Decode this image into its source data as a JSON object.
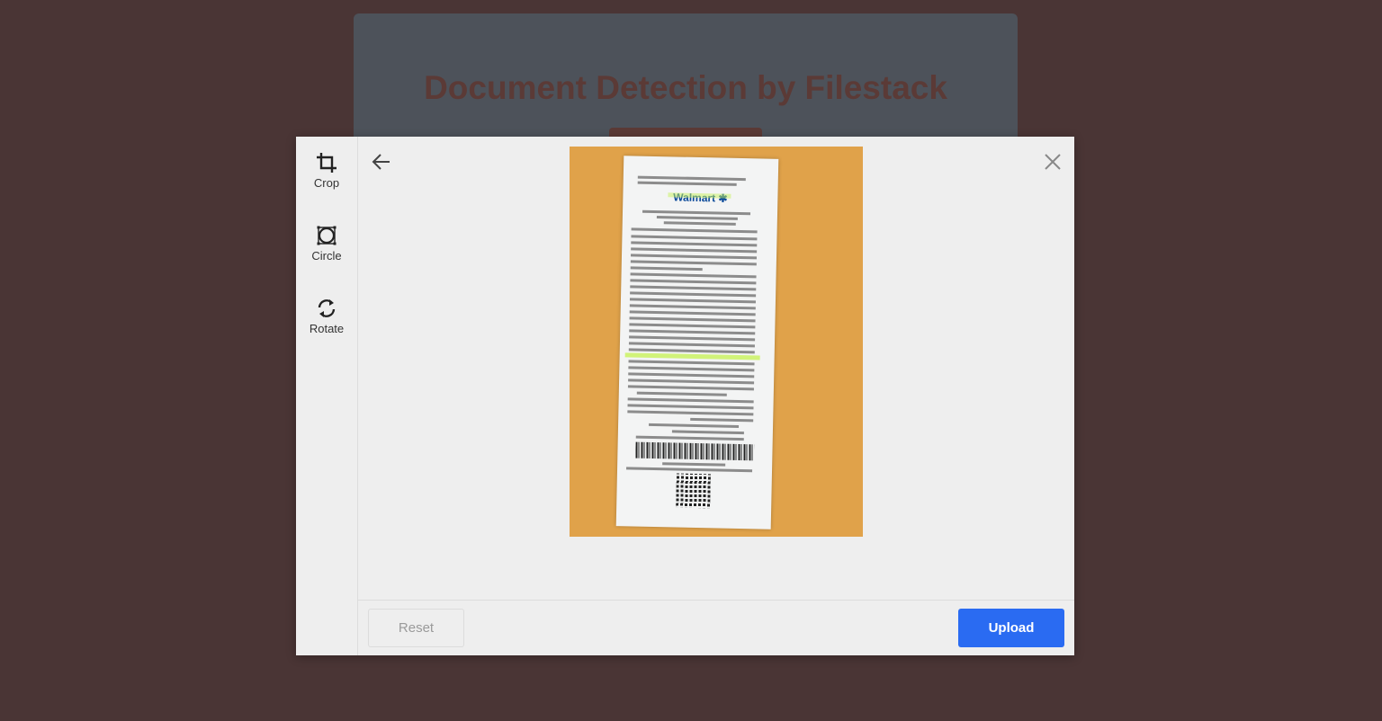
{
  "background": {
    "title": "Document Detection by Filestack"
  },
  "sidebar": {
    "tools": [
      {
        "label": "Crop",
        "icon": "crop-icon"
      },
      {
        "label": "Circle",
        "icon": "circle-icon"
      },
      {
        "label": "Rotate",
        "icon": "rotate-icon"
      }
    ]
  },
  "header": {
    "back_icon": "arrow-left-icon",
    "close_icon": "close-icon"
  },
  "footer": {
    "reset_label": "Reset",
    "upload_label": "Upload"
  },
  "colors": {
    "accent": "#2a6bf2",
    "page_background": "#4a3535",
    "modal_background": "#eeeeee"
  }
}
